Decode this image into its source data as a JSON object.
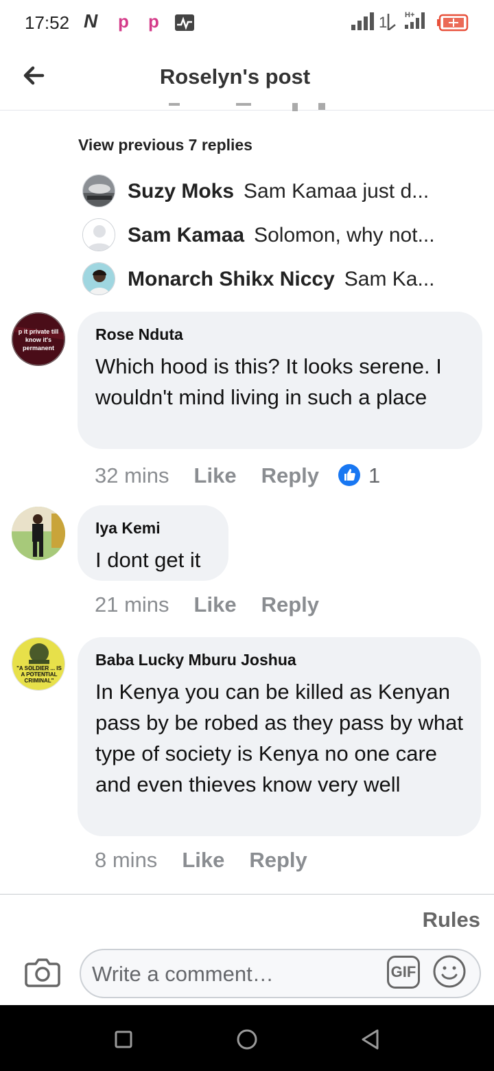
{
  "status_bar": {
    "time": "17:52"
  },
  "header": {
    "title": "Roselyn's post"
  },
  "replies_thread": {
    "view_previous": "View previous 7 replies",
    "items": [
      {
        "author": "Suzy Moks",
        "preview": "Sam Kamaa just d..."
      },
      {
        "author": "Sam Kamaa",
        "preview": "Solomon, why not..."
      },
      {
        "author": "Monarch Shikx Niccy",
        "preview": "Sam Ka..."
      }
    ]
  },
  "comments": [
    {
      "author": "Rose Nduta",
      "avatar_text": "p it private till know it's permanent",
      "text": "Which hood is this?  It looks serene.  I wouldn't mind living in such a place",
      "time": "32 mins",
      "like": "Like",
      "reply": "Reply",
      "reaction_count": "1"
    },
    {
      "author": "Iya Kemi",
      "text": "I dont get it",
      "time": "21 mins",
      "like": "Like",
      "reply": "Reply"
    },
    {
      "author": "Baba Lucky Mburu Joshua",
      "avatar_text": "\"A SOLDIER ... IS A POTENTIAL CRIMINAL\"",
      "text": "In Kenya you can be killed as Kenyan pass by be robed as they pass by what type of society is Kenya no one care and even thieves know very well",
      "time": "8 mins",
      "like": "Like",
      "reply": "Reply"
    }
  ],
  "footer": {
    "rules": "Rules",
    "composer_placeholder": "Write a comment…",
    "gif_label": "GIF"
  },
  "colors": {
    "bubble": "#f0f2f5",
    "meta_text": "#8a8d91",
    "like_blue": "#1877f2"
  }
}
